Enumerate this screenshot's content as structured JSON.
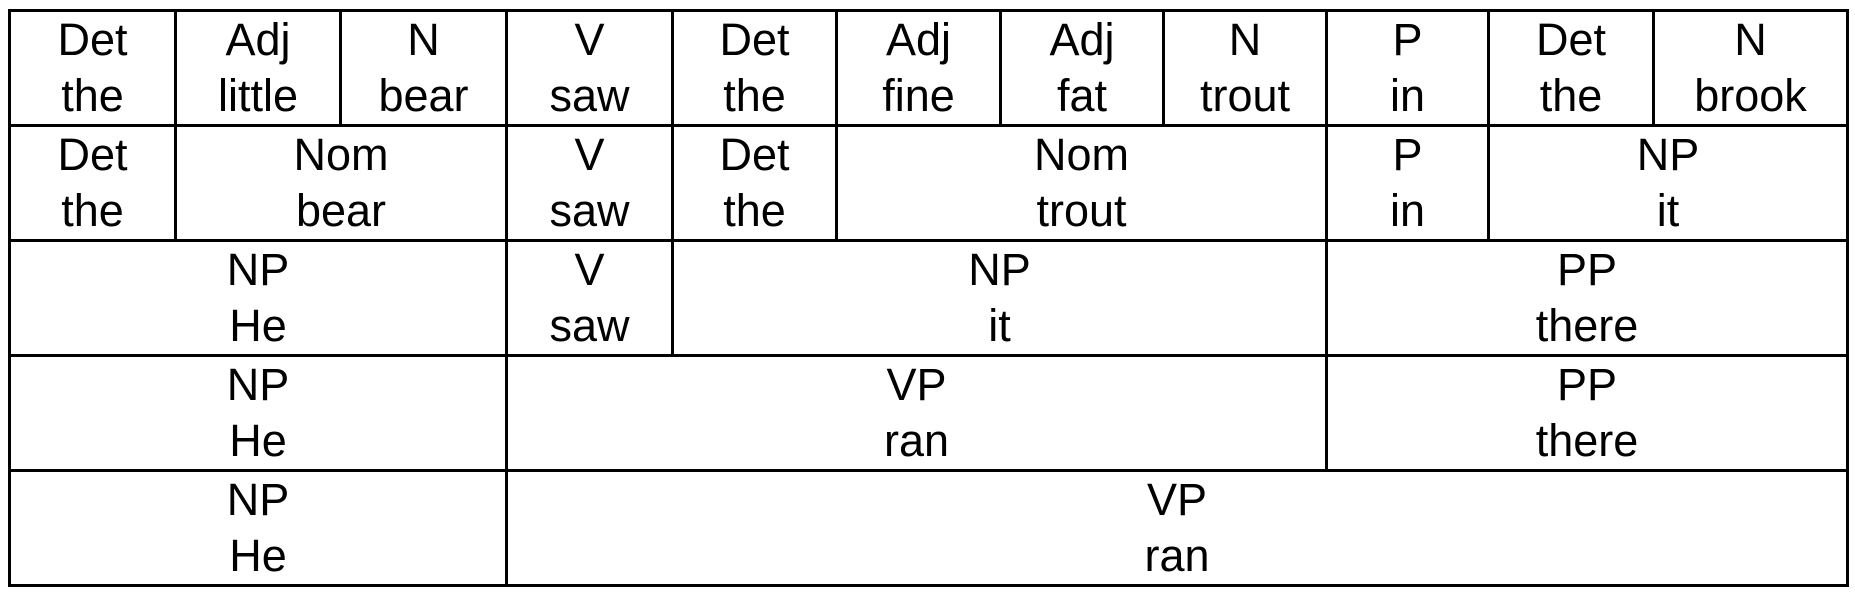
{
  "rows": [
    [
      {
        "label": "Det",
        "word": "the",
        "span": 1
      },
      {
        "label": "Adj",
        "word": "little",
        "span": 1
      },
      {
        "label": "N",
        "word": "bear",
        "span": 1
      },
      {
        "label": "V",
        "word": "saw",
        "span": 1
      },
      {
        "label": "Det",
        "word": "the",
        "span": 1
      },
      {
        "label": "Adj",
        "word": "fine",
        "span": 1
      },
      {
        "label": "Adj",
        "word": "fat",
        "span": 1
      },
      {
        "label": "N",
        "word": "trout",
        "span": 1
      },
      {
        "label": "P",
        "word": "in",
        "span": 1
      },
      {
        "label": "Det",
        "word": "the",
        "span": 1
      },
      {
        "label": "N",
        "word": "brook",
        "span": 1
      }
    ],
    [
      {
        "label": "Det",
        "word": "the",
        "span": 1
      },
      {
        "label": "Nom",
        "word": "bear",
        "span": 2
      },
      {
        "label": "V",
        "word": "saw",
        "span": 1
      },
      {
        "label": "Det",
        "word": "the",
        "span": 1
      },
      {
        "label": "Nom",
        "word": "trout",
        "span": 3
      },
      {
        "label": "P",
        "word": "in",
        "span": 1
      },
      {
        "label": "NP",
        "word": "it",
        "span": 2
      }
    ],
    [
      {
        "label": "NP",
        "word": "He",
        "span": 3
      },
      {
        "label": "V",
        "word": "saw",
        "span": 1
      },
      {
        "label": "NP",
        "word": "it",
        "span": 4
      },
      {
        "label": "PP",
        "word": "there",
        "span": 3
      }
    ],
    [
      {
        "label": "NP",
        "word": "He",
        "span": 3
      },
      {
        "label": "VP",
        "word": "ran",
        "span": 5
      },
      {
        "label": "PP",
        "word": "there",
        "span": 3
      }
    ],
    [
      {
        "label": "NP",
        "word": "He",
        "span": 3
      },
      {
        "label": "VP",
        "word": "ran",
        "span": 8
      }
    ]
  ]
}
